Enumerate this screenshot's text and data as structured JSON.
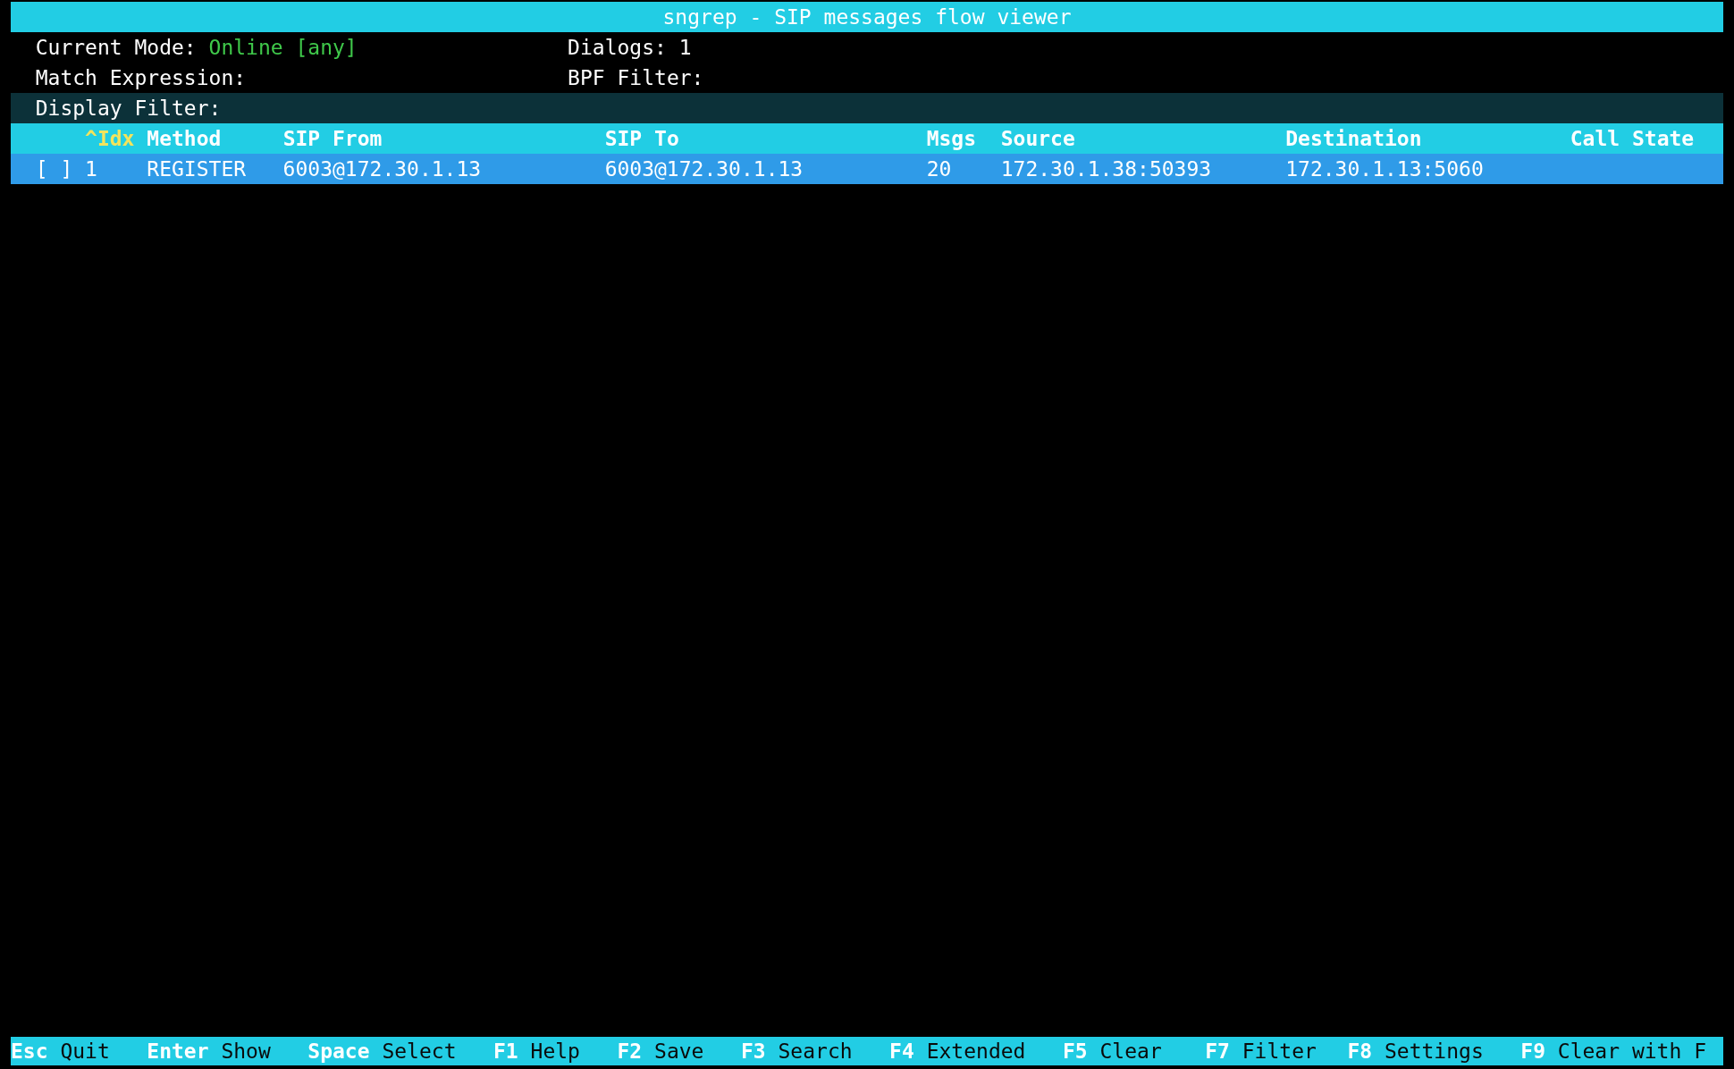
{
  "window": {
    "title": "sngrep - SIP messages flow viewer"
  },
  "info": {
    "current_mode_label": "Current Mode:",
    "current_mode_value": "Online [any]",
    "dialogs": "Dialogs: 1",
    "match_expression": "Match Expression:",
    "bpf_filter": "BPF Filter:"
  },
  "display_filter": {
    "label": "Display Filter:"
  },
  "table": {
    "columns": [
      {
        "label": "^Idx",
        "sorted": true
      },
      {
        "label": "Method",
        "sorted": false
      },
      {
        "label": "SIP From",
        "sorted": false
      },
      {
        "label": "SIP To",
        "sorted": false
      },
      {
        "label": "Msgs",
        "sorted": false
      },
      {
        "label": "Source",
        "sorted": false
      },
      {
        "label": "Destination",
        "sorted": false
      },
      {
        "label": "Call State",
        "sorted": false
      }
    ],
    "rows": [
      {
        "checkbox": "[ ]",
        "selected": true,
        "cells": [
          "1",
          "REGISTER",
          "6003@172.30.1.13",
          "6003@172.30.1.13",
          "20",
          "172.30.1.38:50393",
          "172.30.1.13:5060"
        ]
      }
    ]
  },
  "status_bar": [
    {
      "key": "Esc",
      "action": "Quit"
    },
    {
      "key": "Enter",
      "action": "Show"
    },
    {
      "key": "Space",
      "action": "Select"
    },
    {
      "key": "F1",
      "action": "Help"
    },
    {
      "key": "F2",
      "action": "Save"
    },
    {
      "key": "F3",
      "action": "Search"
    },
    {
      "key": "F4",
      "action": "Extended"
    },
    {
      "key": "F5",
      "action": "Clear"
    },
    {
      "key": "F7",
      "action": "Filter"
    },
    {
      "key": "F8",
      "action": "Settings"
    },
    {
      "key": "F9",
      "action": "Clear with F"
    }
  ]
}
